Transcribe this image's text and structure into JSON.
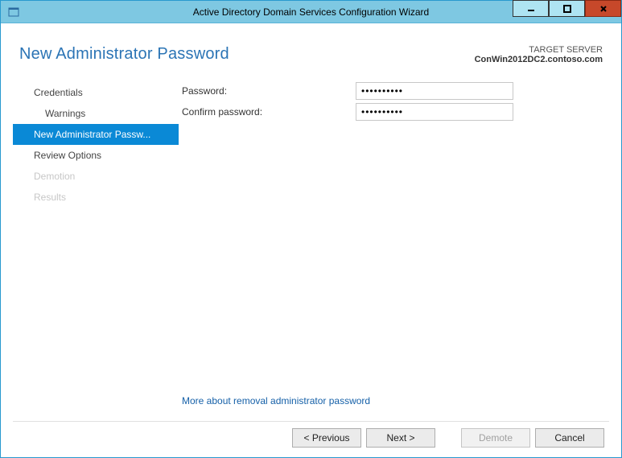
{
  "window": {
    "title": "Active Directory Domain Services Configuration Wizard"
  },
  "header": {
    "heading": "New Administrator Password",
    "target_label": "TARGET SERVER",
    "target_name": "ConWin2012DC2.contoso.com"
  },
  "sidebar": {
    "items": [
      {
        "label": "Credentials",
        "selected": false,
        "disabled": false,
        "child": false
      },
      {
        "label": "Warnings",
        "selected": false,
        "disabled": false,
        "child": true
      },
      {
        "label": "New Administrator Passw...",
        "selected": true,
        "disabled": false,
        "child": false
      },
      {
        "label": "Review Options",
        "selected": false,
        "disabled": false,
        "child": false
      },
      {
        "label": "Demotion",
        "selected": false,
        "disabled": true,
        "child": false
      },
      {
        "label": "Results",
        "selected": false,
        "disabled": true,
        "child": false
      }
    ]
  },
  "form": {
    "password_label": "Password:",
    "confirm_label": "Confirm password:",
    "password_value": "••••••••••",
    "confirm_value": "••••••••••",
    "more_link": "More about removal administrator password"
  },
  "buttons": {
    "previous": "< Previous",
    "next": "Next >",
    "demote": "Demote",
    "cancel": "Cancel"
  }
}
